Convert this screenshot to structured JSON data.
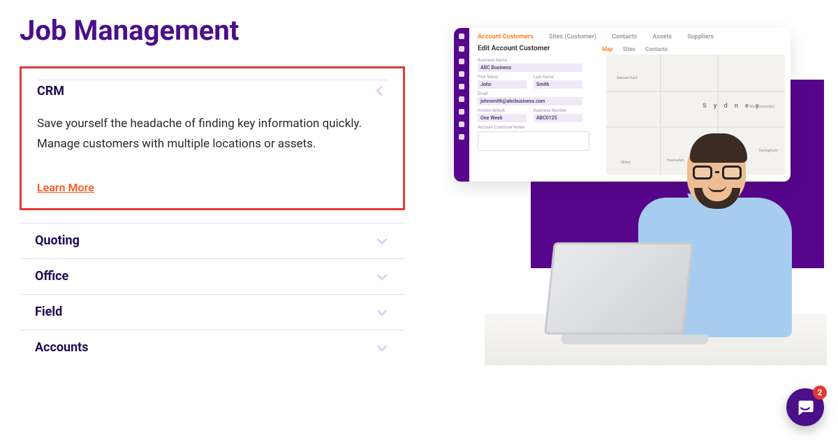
{
  "page": {
    "title": "Job Management"
  },
  "crm": {
    "title": "CRM",
    "body": "Save yourself the headache of finding key information quickly. Manage customers with multiple locations or assets.",
    "learn_more": "Learn More"
  },
  "accordion": [
    {
      "label": "Quoting"
    },
    {
      "label": "Office"
    },
    {
      "label": "Field"
    },
    {
      "label": "Accounts"
    }
  ],
  "screenshot": {
    "tabs": [
      "Account Customers",
      "Sites (Customer)",
      "Contacts",
      "Assets",
      "Suppliers"
    ],
    "active_tab": 0,
    "subtitle": "Edit Account Customer",
    "subtabs": [
      "Map",
      "Sites",
      "Contacts"
    ],
    "active_subtab": 0,
    "labels": {
      "business_name": "Business Name",
      "first_name": "First Name",
      "last_name": "Last Name",
      "email": "Email",
      "invoice_default": "Invoice default",
      "business_number": "Business Number",
      "notes": "Account Customer Notes"
    },
    "values": {
      "business_name": "ABC Business",
      "first_name": "John",
      "last_name": "Smith",
      "email": "johnsmith@abcbusiness.com",
      "invoice_default": "One Week",
      "business_number": "ABC0125"
    },
    "map": {
      "city": "S y d n e y",
      "labels": [
        "Balmain East",
        "Woolloomooloo",
        "Darlinghurst",
        "Haymarket",
        "Ultimo"
      ]
    }
  },
  "chat": {
    "badge": "2"
  }
}
